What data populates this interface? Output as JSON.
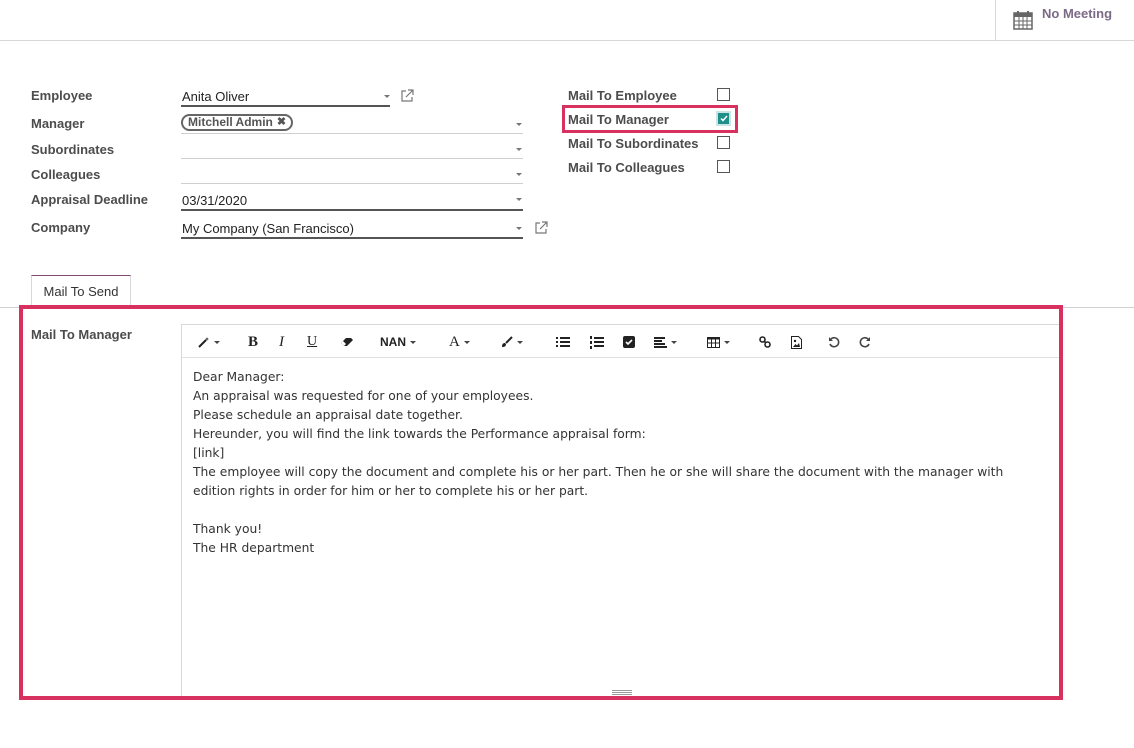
{
  "header": {
    "meeting_button": {
      "label": "No Meeting",
      "icon": "calendar-icon"
    }
  },
  "form": {
    "left_fields": [
      {
        "label": "Employee",
        "value": "Anita Oliver"
      },
      {
        "label": "Manager",
        "tags": [
          "Mitchell Admin"
        ]
      },
      {
        "label": "Subordinates",
        "value": ""
      },
      {
        "label": "Colleagues",
        "value": ""
      },
      {
        "label": "Appraisal Deadline",
        "value": "03/31/2020"
      },
      {
        "label": "Company",
        "value": "My Company (San Francisco)"
      }
    ],
    "manager_tag_remove": "✖",
    "right_checkboxes": [
      {
        "label": "Mail To Employee",
        "checked": false
      },
      {
        "label": "Mail To Manager",
        "checked": true
      },
      {
        "label": "Mail To Subordinates",
        "checked": false
      },
      {
        "label": "Mail To Colleagues",
        "checked": false
      }
    ]
  },
  "tabs": [
    {
      "label": "Mail To Send",
      "active": true
    }
  ],
  "mail_section": {
    "label": "Mail To Manager",
    "toolbar": {
      "style_icon": "magic-wand-icon",
      "bold": "B",
      "italic": "I",
      "underline": "U",
      "eraser_icon": "eraser-icon",
      "font_size": "NAN",
      "font_color": "A",
      "brush_icon": "brush-icon",
      "unordered_list_icon": "list-ul-icon",
      "ordered_list_icon": "list-ol-icon",
      "checklist_icon": "checkbox-icon",
      "align_icon": "align-left-icon",
      "table_icon": "table-icon",
      "link_icon": "link-icon",
      "image_icon": "image-icon",
      "undo_icon": "undo-icon",
      "redo_icon": "redo-icon"
    },
    "body_lines": [
      "Dear Manager:",
      "An appraisal was requested for one of your employees.",
      "Please schedule an appraisal date together.",
      "Hereunder, you will find the link towards the Performance appraisal form:",
      "[link]",
      "The employee will copy the document and complete his or her part. Then he or she will share the document with the manager with edition rights in order for him or her to complete his or her part.",
      "",
      "Thank you!",
      "The HR department"
    ]
  },
  "colors": {
    "highlight": "#d8315f",
    "checkbox_checked": "#1f8f8a",
    "meeting_label": "#7c6a86"
  }
}
